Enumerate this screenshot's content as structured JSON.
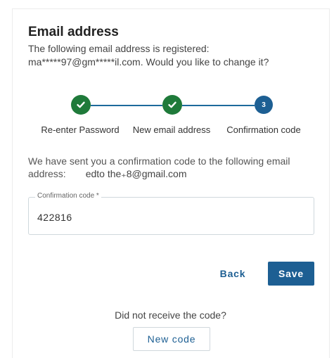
{
  "header": {
    "title": "Email address",
    "subtitle": "The following email address is registered: ma*****97@gm*****il.com. Would you like to change it?"
  },
  "stepper": {
    "steps": [
      {
        "label": "Re-enter Password",
        "state": "done",
        "icon": "check-icon"
      },
      {
        "label": "New email address",
        "state": "done",
        "icon": "check-icon"
      },
      {
        "label": "Confirmation code",
        "state": "active",
        "number": "3"
      }
    ],
    "colors": {
      "done": "#1f7a3a",
      "active": "#1d5f93",
      "line": "#1d6a9c"
    }
  },
  "info": {
    "text": "We have sent you a confirmation code to the following email address:",
    "email": "edto the₊8@gmail.com"
  },
  "confirmation_field": {
    "label": "Confirmation code *",
    "value": "422816"
  },
  "actions": {
    "back_label": "Back",
    "save_label": "Save"
  },
  "resend": {
    "prompt": "Did not receive the code?",
    "button_label": "New code"
  },
  "colors": {
    "accent": "#1d5f93",
    "success": "#1f7a3a"
  }
}
